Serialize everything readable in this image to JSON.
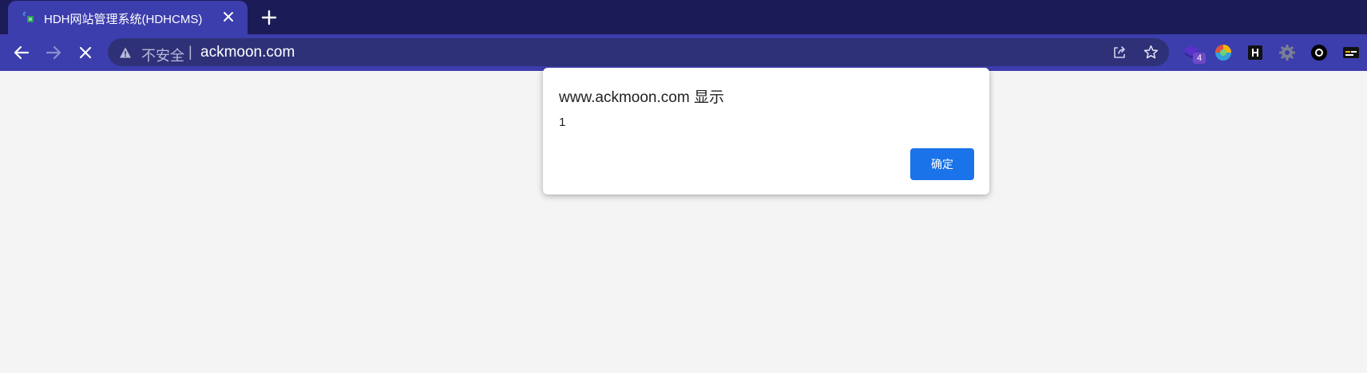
{
  "tab": {
    "title": "HDH网站管理系统(HDHCMS)"
  },
  "omnibox": {
    "security_label": "不安全",
    "separator": "|",
    "url": "ackmoon.com"
  },
  "extensions": {
    "badge_count": "4"
  },
  "dialog": {
    "title": "www.ackmoon.com 显示",
    "message": "1",
    "ok_label": "确定"
  },
  "colors": {
    "tabstrip_bg": "#1b1b57",
    "toolbar_bg": "#3c3ead",
    "omnibox_bg": "#2e3178",
    "page_bg": "#f4f4f4",
    "ok_button": "#1a73e8"
  }
}
